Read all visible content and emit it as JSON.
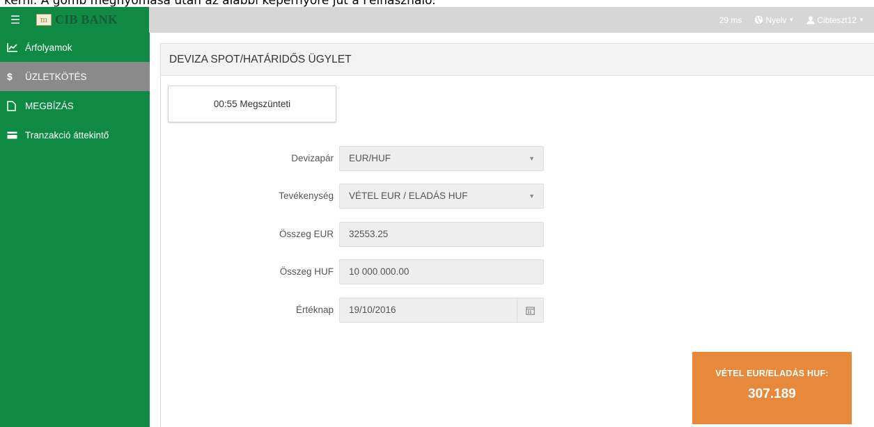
{
  "caption": "kérni. A gomb megnyomása után az alábbi képernyőre jut a Felhasználó.",
  "header": {
    "logo_mark": "m",
    "logo_text": "CIB BANK",
    "latency": "29 ms",
    "language_label": "Nyelv",
    "user_label": "Cibteszt12"
  },
  "sidebar": {
    "items": [
      {
        "label": "Árfolyamok",
        "icon": "chart-line-icon",
        "active": false
      },
      {
        "label": "ÜZLETKÖTÉS",
        "icon": "dollar-icon",
        "active": true
      },
      {
        "label": "MEGBÍZÁS",
        "icon": "document-icon",
        "active": false
      },
      {
        "label": "Tranzakció áttekintő",
        "icon": "card-icon",
        "active": false
      }
    ]
  },
  "main": {
    "title": "DEVIZA SPOT/HATÁRIDŐS ÜGYLET",
    "cancel_button": "00:55 Megszünteti",
    "form": {
      "currency_pair": {
        "label": "Devizapár",
        "value": "EUR/HUF"
      },
      "activity": {
        "label": "Tevékenység",
        "value": "VÉTEL EUR / ELADÁS HUF"
      },
      "amount_eur": {
        "label": "Összeg EUR",
        "value": "32553.25"
      },
      "amount_huf": {
        "label": "Összeg HUF",
        "value": "10 000 000.00"
      },
      "value_date": {
        "label": "Értéknap",
        "value": "19/10/2016"
      }
    },
    "rate": {
      "label": "VÉTEL EUR/ELADÁS HUF:",
      "value": "307.189"
    }
  },
  "colors": {
    "brand_green": "#0f8a45",
    "active_item": "#8a8a8a",
    "rate_orange": "#e8883a"
  }
}
